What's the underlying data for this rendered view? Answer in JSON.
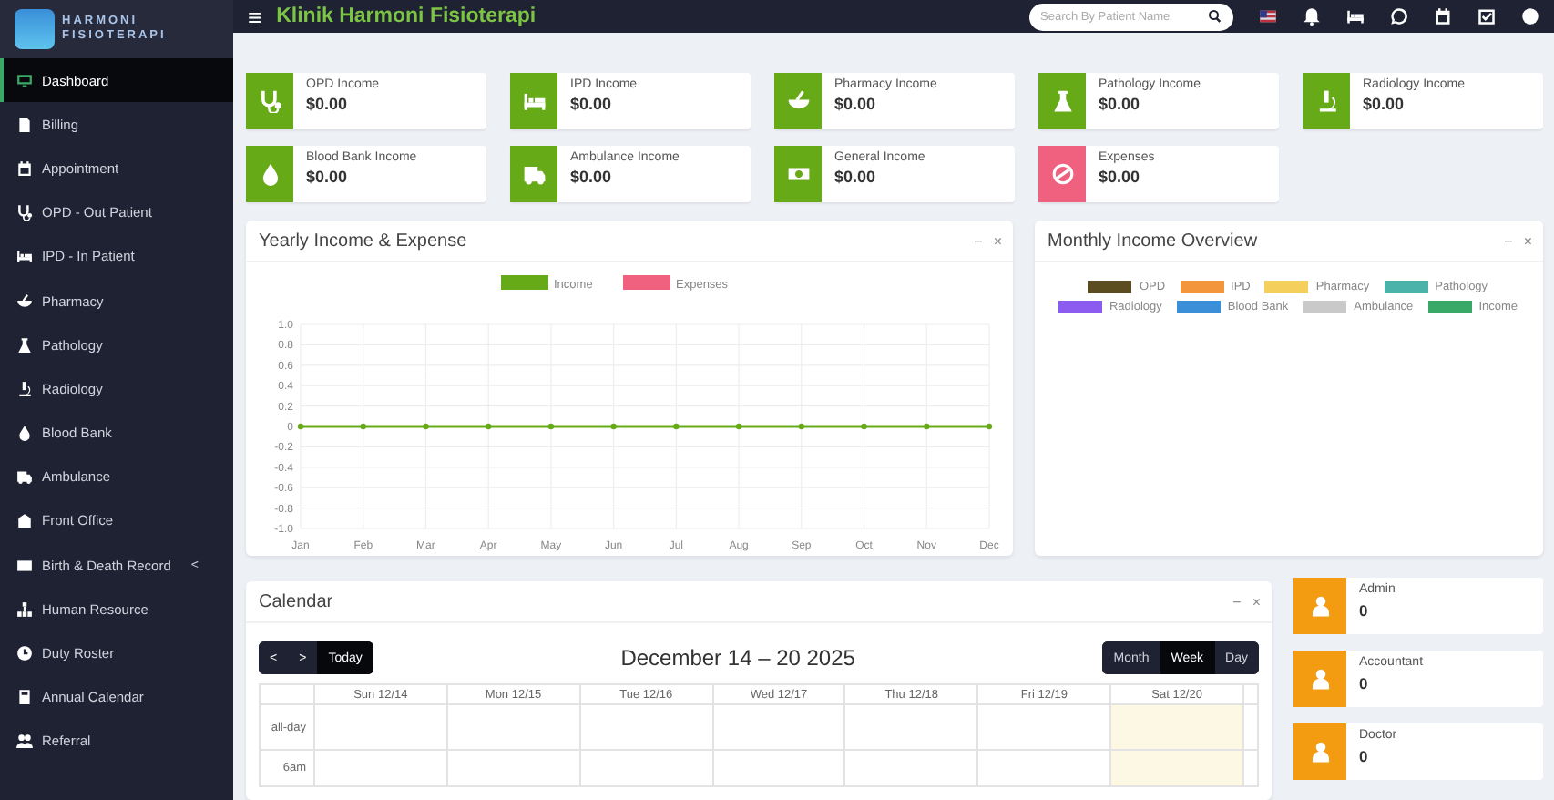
{
  "sidebar": {
    "logo": {
      "line_1": "HARMONI",
      "line_2": "FISIOTERAPI"
    },
    "items": [
      {
        "label": "Dashboard",
        "selected": true
      },
      {
        "label": "Billing",
        "selected": false
      },
      {
        "label": "Appointment",
        "selected": false
      },
      {
        "label": "OPD - Out Patient",
        "selected": false
      },
      {
        "label": "IPD - In Patient",
        "selected": false
      },
      {
        "label": "Pharmacy",
        "selected": false
      },
      {
        "label": "Pathology",
        "selected": false
      },
      {
        "label": "Radiology",
        "selected": false
      },
      {
        "label": "Blood Bank",
        "selected": false
      },
      {
        "label": "Ambulance",
        "selected": false
      },
      {
        "label": "Front Office",
        "selected": false
      },
      {
        "label": "Birth & Death Record",
        "selected": false,
        "caret": "<"
      },
      {
        "label": "Human Resource",
        "selected": false
      },
      {
        "label": "Duty Roster",
        "selected": false
      },
      {
        "label": "Annual Calendar",
        "selected": false
      },
      {
        "label": "Referral",
        "selected": false
      }
    ]
  },
  "topbar": {
    "menu": "≡",
    "title": "Klinik Harmoni Fisioterapi",
    "search": {
      "placeholder": "Search By Patient Name"
    }
  },
  "stat_cards": [
    {
      "label": "OPD Income",
      "value": "$0.00",
      "color": "#66aa18"
    },
    {
      "label": "IPD Income",
      "value": "$0.00",
      "color": "#66aa18"
    },
    {
      "label": "Pharmacy Income",
      "value": "$0.00",
      "color": "#66aa18"
    },
    {
      "label": "Pathology Income",
      "value": "$0.00",
      "color": "#66aa18"
    },
    {
      "label": "Radiology Income",
      "value": "$0.00",
      "color": "#66aa18"
    },
    {
      "label": "Blood Bank Income",
      "value": "$0.00",
      "color": "#66aa18"
    },
    {
      "label": "Ambulance Income",
      "value": "$0.00",
      "color": "#66aa18"
    },
    {
      "label": "General Income",
      "value": "$0.00",
      "color": "#66aa18"
    },
    {
      "label": "Expenses",
      "value": "$0.00",
      "color": "#f0607f"
    }
  ],
  "yearly_panel": {
    "title": "Yearly Income & Expense",
    "tools": [
      "−",
      "×"
    ],
    "chart_data": {
      "type": "line",
      "categories": [
        "Jan",
        "Feb",
        "Mar",
        "Apr",
        "May",
        "Jun",
        "Jul",
        "Aug",
        "Sep",
        "Oct",
        "Nov",
        "Dec"
      ],
      "series": [
        {
          "name": "Income",
          "color": "#66aa18",
          "marker": true,
          "values": [
            0,
            0,
            0,
            0,
            0,
            0,
            0,
            0,
            0,
            0,
            0,
            0
          ]
        },
        {
          "name": "Expenses",
          "color": "#f0607f",
          "marker": true,
          "values": [
            null,
            null,
            null,
            null,
            null,
            null,
            null,
            null,
            null,
            null,
            null,
            null
          ]
        }
      ],
      "grid": true,
      "legend": "top",
      "ylim": [
        -1,
        1
      ],
      "yticks": [
        {
          "value": 1,
          "label": "1.0"
        },
        {
          "value": 0.8,
          "label": "0.8"
        },
        {
          "value": 0.6,
          "label": "0.6"
        },
        {
          "value": 0.4,
          "label": "0.4"
        },
        {
          "value": 0.2,
          "label": "0.2"
        },
        {
          "value": 0,
          "label": "0"
        },
        {
          "value": -0.2,
          "label": "-0.2"
        },
        {
          "value": -0.4,
          "label": "-0.4"
        },
        {
          "value": -0.6,
          "label": "-0.6"
        },
        {
          "value": -0.8,
          "label": "-0.8"
        },
        {
          "value": -1,
          "label": "-1.0"
        }
      ]
    }
  },
  "monthly_panel": {
    "title": "Monthly Income Overview",
    "tools": [
      "−",
      "×"
    ],
    "legend": [
      {
        "label": "OPD",
        "color": "#5b4d1f"
      },
      {
        "label": "IPD",
        "color": "#f2953b"
      },
      {
        "label": "Pharmacy",
        "color": "#f4cf5c"
      },
      {
        "label": "Pathology",
        "color": "#4cb3aa"
      },
      {
        "label": "Radiology",
        "color": "#8c5cf0"
      },
      {
        "label": "Blood Bank",
        "color": "#3b8fd8"
      },
      {
        "label": "Ambulance",
        "color": "#c9c9c9"
      },
      {
        "label": "Income",
        "color": "#3aa866"
      }
    ]
  },
  "calendar_panel": {
    "title": "Calendar",
    "tools": [
      "−",
      "×"
    ],
    "prev": "<",
    "next": ">",
    "today": "Today",
    "range": "December 14 – 20 2025",
    "views": [
      {
        "label": "Month",
        "selected": false
      },
      {
        "label": "Week",
        "selected": true
      },
      {
        "label": "Day",
        "selected": false
      }
    ],
    "days": [
      {
        "label": "Sun 12/14",
        "today": false
      },
      {
        "label": "Mon 12/15",
        "today": false
      },
      {
        "label": "Tue 12/16",
        "today": false
      },
      {
        "label": "Wed 12/17",
        "today": false
      },
      {
        "label": "Thu 12/18",
        "today": false
      },
      {
        "label": "Fri 12/19",
        "today": false
      },
      {
        "label": "Sat 12/20",
        "today": true
      }
    ],
    "rows": [
      "all-day",
      "6am"
    ]
  },
  "staff_cards": [
    {
      "label": "Admin",
      "value": "0"
    },
    {
      "label": "Accountant",
      "value": "0"
    },
    {
      "label": "Doctor",
      "value": "0"
    }
  ]
}
